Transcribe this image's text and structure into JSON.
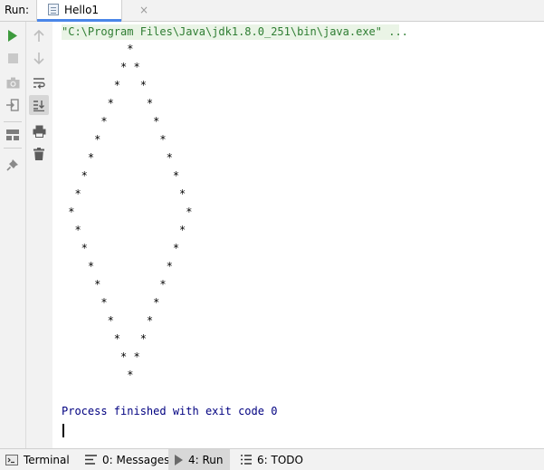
{
  "header": {
    "run_label": "Run:",
    "tab_title": "Hello1",
    "tab_close": "×"
  },
  "console": {
    "command": "\"C:\\Program Files\\Java\\jdk1.8.0_251\\bin\\java.exe\" ...",
    "lines": [
      "          *",
      "         * *",
      "        *   *",
      "       *     *",
      "      *       *",
      "     *         *",
      "    *           *",
      "   *             *",
      "  *               *",
      " *                 *",
      "  *               *",
      "   *             *",
      "    *           *",
      "     *         *",
      "      *       *",
      "       *     *",
      "        *   *",
      "         * *",
      "          *"
    ],
    "finished": "Process finished with exit code 0"
  },
  "bottom": {
    "items": [
      {
        "label": "Terminal",
        "icon": "terminal-icon"
      },
      {
        "label": "0: Messages",
        "icon": "messages-icon"
      },
      {
        "label": "4: Run",
        "icon": "run-icon"
      },
      {
        "label": "6: TODO",
        "icon": "todo-icon"
      }
    ]
  },
  "colors": {
    "run_green": "#3d9a3d",
    "command_text": "#2e7d32",
    "command_bg": "#eaf4e6",
    "exit_text": "#000080",
    "tab_underline": "#4a86e8"
  }
}
